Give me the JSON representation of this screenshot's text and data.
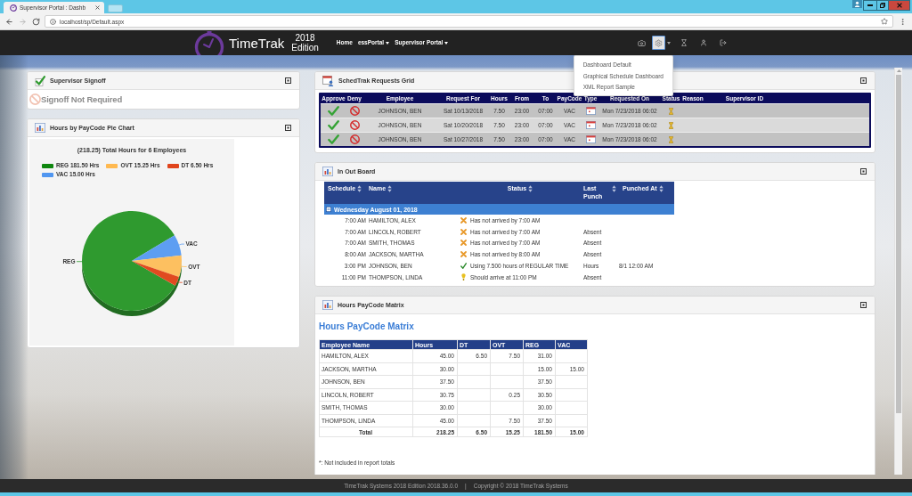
{
  "browser": {
    "tab_title": "Supervisor Portal : Dashb",
    "url": "localhost/sp/Default.aspx"
  },
  "navbar": {
    "brand": "TimeTrak",
    "edition_year": "2018",
    "edition_label": "Edition",
    "links": [
      {
        "label": "Home",
        "dropdown": false
      },
      {
        "label": "essPortal",
        "dropdown": true
      },
      {
        "label": "Supervisor Portal",
        "dropdown": true
      }
    ],
    "settings_button": {
      "selected": true
    }
  },
  "settings_menu": {
    "items": [
      "Dashboard Default",
      "Graphical Schedule Dashboard",
      "XML Report Sample"
    ]
  },
  "supervisor_signoff": {
    "title": "Supervisor Signoff",
    "message": "Signoff Not Required"
  },
  "pie_panel": {
    "title": "Hours by PayCode Pie Chart",
    "legend": [
      {
        "label": "REG 181.50 Hrs",
        "color": "#0f870f"
      },
      {
        "label": "OVT 15.25 Hrs",
        "color": "#ffb950"
      },
      {
        "label": "DT 6.50 Hrs",
        "color": "#e0441c"
      },
      {
        "label": "VAC 15.00 Hrs",
        "color": "#5096f0"
      }
    ],
    "chart_data": {
      "type": "pie",
      "title": "(218.25) Total Hours for 6 Employees",
      "categories": [
        "REG",
        "VAC",
        "OVT",
        "DT"
      ],
      "values": [
        83.16,
        6.87,
        6.99,
        2.98
      ],
      "colors": [
        "#2f9a2f",
        "#5d9ef2",
        "#fdc060",
        "#e04a20"
      ]
    }
  },
  "requests_grid": {
    "title": "SchedTrak Requests Grid",
    "columns": [
      "Approve",
      "Deny",
      "Employee",
      "Request For",
      "Hours",
      "From",
      "To",
      "PayCode",
      "Type",
      "Requested On",
      "Status",
      "Reason",
      "Supervisor ID"
    ],
    "rows": [
      {
        "employee": "JOHNSON, BEN",
        "request_for": "Sat 10/13/2018",
        "hours": "7.50",
        "from": "23:00",
        "to": "07:00",
        "paycode": "VAC",
        "requested_on": "Mon 7/23/2018 06:02"
      },
      {
        "employee": "JOHNSON, BEN",
        "request_for": "Sat 10/20/2018",
        "hours": "7.50",
        "from": "23:00",
        "to": "07:00",
        "paycode": "VAC",
        "requested_on": "Mon 7/23/2018 06:02"
      },
      {
        "employee": "JOHNSON, BEN",
        "request_for": "Sat 10/27/2018",
        "hours": "7.50",
        "from": "23:00",
        "to": "07:00",
        "paycode": "VAC",
        "requested_on": "Mon 7/23/2018 06:02"
      }
    ]
  },
  "in_out_board": {
    "title": "In Out Board",
    "columns": [
      "Schedule",
      "Name",
      "Status",
      "Last Punch",
      "Punched At"
    ],
    "group": {
      "label": "Wednesday August 01, 2018",
      "expanded": true
    },
    "rows": [
      {
        "kind": "missed",
        "schedule": "7:00 AM",
        "name": "HAMILTON, ALEX",
        "status": "Has not arrived by 7:00 AM"
      },
      {
        "kind": "missed",
        "schedule": "7:00 AM",
        "name": "LINCOLN, ROBERT",
        "status": "Has not arrived by 7:00 AM",
        "last_punch": "Absent"
      },
      {
        "kind": "missed",
        "schedule": "7:00 AM",
        "name": "SMITH, THOMAS",
        "status": "Has not arrived by 7:00 AM",
        "last_punch": "Absent"
      },
      {
        "kind": "missed",
        "schedule": "8:00 AM",
        "name": "JACKSON, MARTHA",
        "status": "Has not arrived by 8:00 AM",
        "last_punch": "Absent"
      },
      {
        "kind": "working",
        "schedule": "3:00 PM",
        "name": "JOHNSON, BEN",
        "status": "Using 7.500 hours of REGULAR TIME",
        "last_punch": "Hours",
        "punched_at": "8/1 12:00 AM"
      },
      {
        "kind": "expected",
        "schedule": "11:00 PM",
        "name": "THOMPSON, LINDA",
        "status": "Should arrive at 11:00 PM",
        "last_punch": "Absent"
      }
    ]
  },
  "paycode_matrix": {
    "title": "Hours PayCode Matrix",
    "heading": "Hours PayCode Matrix",
    "columns": [
      "Employee Name",
      "Hours",
      "DT",
      "OVT",
      "REG",
      "VAC"
    ],
    "rows": [
      {
        "name": "HAMILTON, ALEX",
        "hours": "45.00",
        "dt": "6.50",
        "ovt": "7.50",
        "reg": "31.00"
      },
      {
        "name": "JACKSON, MARTHA",
        "hours": "30.00",
        "reg": "15.00",
        "vac": "15.00"
      },
      {
        "name": "JOHNSON, BEN",
        "hours": "37.50",
        "reg": "37.50"
      },
      {
        "name": "LINCOLN, ROBERT",
        "hours": "30.75",
        "ovt": "0.25",
        "reg": "30.50"
      },
      {
        "name": "SMITH, THOMAS",
        "hours": "30.00",
        "reg": "30.00"
      },
      {
        "name": "THOMPSON, LINDA",
        "hours": "45.00",
        "ovt": "7.50",
        "reg": "37.50"
      }
    ],
    "total": {
      "name": "Total",
      "hours": "218.25",
      "dt": "6.50",
      "ovt": "15.25",
      "reg": "181.50",
      "vac": "15.00"
    },
    "footnote": "*: Not included in report totals"
  },
  "footer": {
    "version": "TimeTrak Systems 2018 Edition 2018.36.0.0",
    "separator": "|",
    "copyright": "Copyright © 2018 TimeTrak Systems"
  }
}
